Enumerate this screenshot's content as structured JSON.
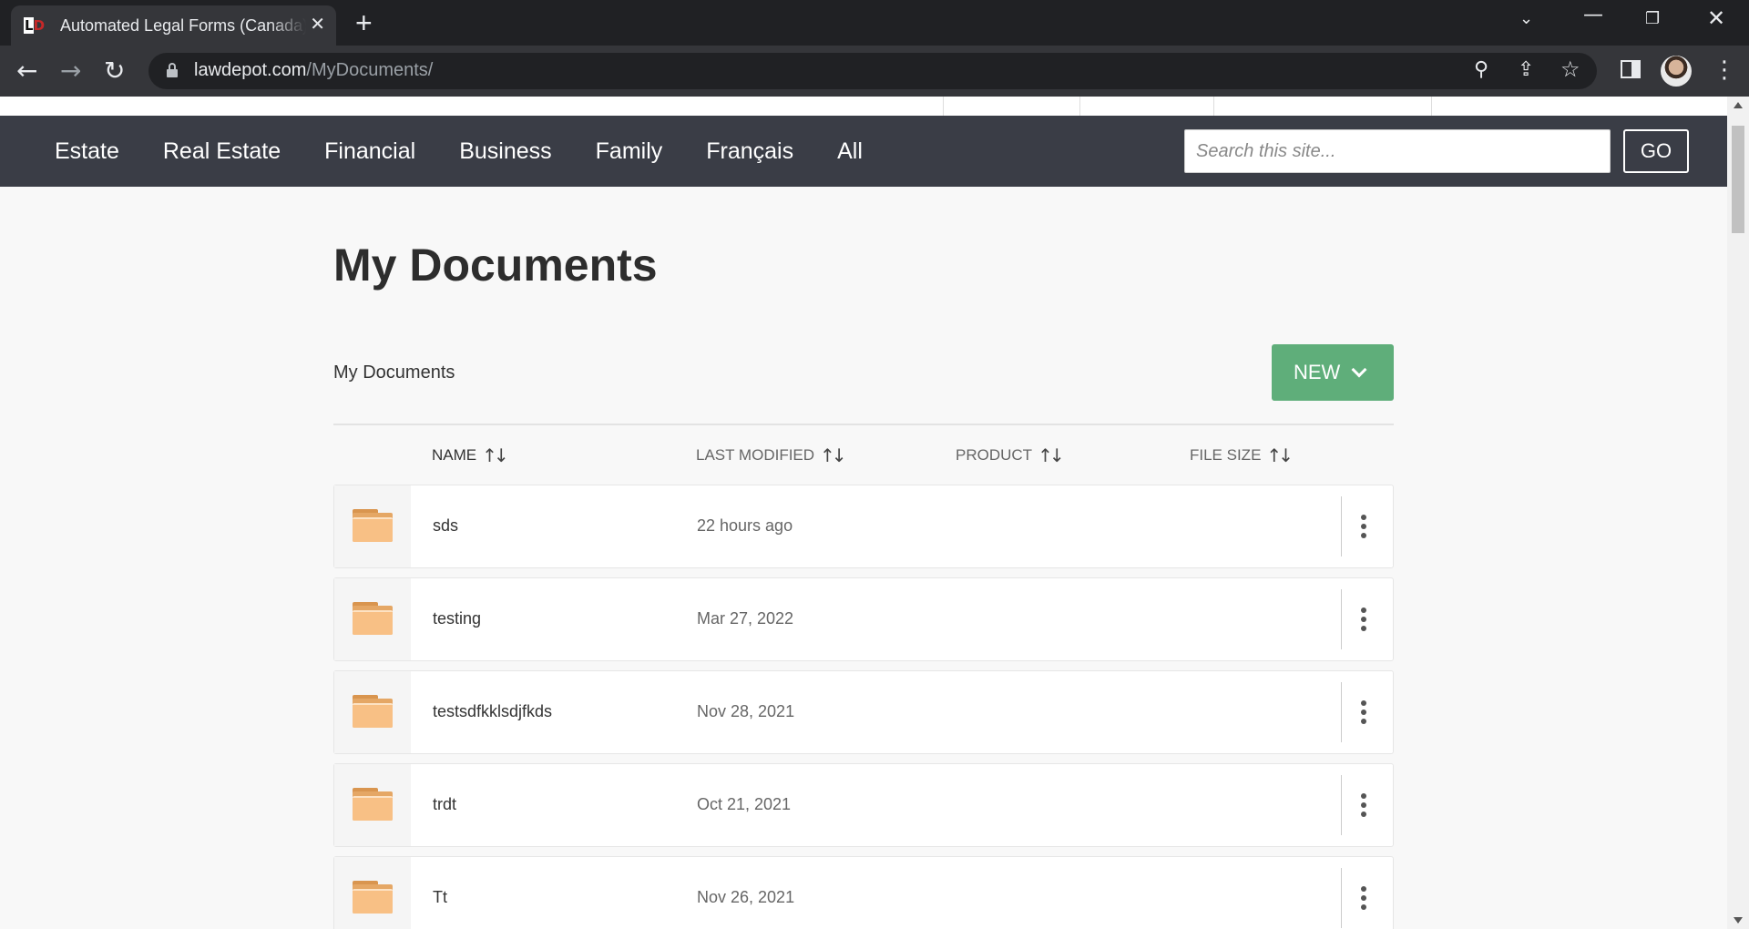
{
  "browser": {
    "tab_title": "Automated Legal Forms (Canada)",
    "favicon_text": "LD",
    "url_host": "lawdepot.com",
    "url_path": "/MyDocuments/"
  },
  "nav": {
    "items": [
      "Estate",
      "Real Estate",
      "Financial",
      "Business",
      "Family",
      "Français",
      "All"
    ],
    "search_placeholder": "Search this site...",
    "go_label": "GO"
  },
  "page": {
    "title": "My Documents",
    "breadcrumb": "My Documents",
    "new_label": "NEW"
  },
  "table": {
    "columns": {
      "name": "NAME",
      "modified": "LAST MODIFIED",
      "product": "PRODUCT",
      "size": "FILE SIZE",
      "sort_icon": "↑↓"
    },
    "rows": [
      {
        "name": "sds",
        "modified": "22 hours ago",
        "product": "",
        "size": "—"
      },
      {
        "name": "testing",
        "modified": "Mar 27, 2022",
        "product": "",
        "size": "—"
      },
      {
        "name": "testsdfkklsdjfkds",
        "modified": "Nov 28, 2021",
        "product": "",
        "size": "—"
      },
      {
        "name": "trdt",
        "modified": "Oct 21, 2021",
        "product": "",
        "size": "—"
      },
      {
        "name": "Tt",
        "modified": "Nov 26, 2021",
        "product": "",
        "size": "—"
      }
    ]
  },
  "colors": {
    "nav_bg": "#3a3d46",
    "new_button": "#5fae7a",
    "folder": "#f8c085"
  }
}
